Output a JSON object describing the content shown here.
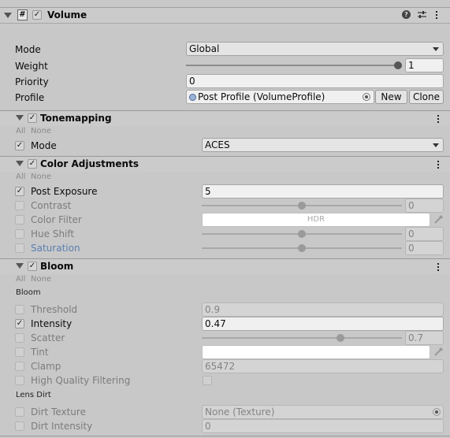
{
  "component": {
    "title": "Volume",
    "enabled": true,
    "icons": [
      "help-icon",
      "presets-icon",
      "more-icon"
    ]
  },
  "volume": {
    "mode_label": "Mode",
    "mode_value": "Global",
    "weight_label": "Weight",
    "weight_value": "1",
    "weight_fraction": 1,
    "priority_label": "Priority",
    "priority_value": "0",
    "profile_label": "Profile",
    "profile_value": "Post Profile (VolumeProfile)",
    "new_button": "New",
    "clone_button": "Clone"
  },
  "all_label": "All",
  "none_label": "None",
  "tonemapping": {
    "title": "Tonemapping",
    "mode_label": "Mode",
    "mode_value": "ACES"
  },
  "color_adjustments": {
    "title": "Color Adjustments",
    "post_exposure_label": "Post Exposure",
    "post_exposure_value": "5",
    "contrast_label": "Contrast",
    "contrast_value": "0",
    "contrast_fraction": 0.5,
    "color_filter_label": "Color Filter",
    "color_filter_hdr": "HDR",
    "hue_shift_label": "Hue Shift",
    "hue_shift_value": "0",
    "hue_shift_fraction": 0.5,
    "saturation_label": "Saturation",
    "saturation_value": "0",
    "saturation_fraction": 0.5
  },
  "bloom": {
    "title": "Bloom",
    "group_bloom": "Bloom",
    "threshold_label": "Threshold",
    "threshold_value": "0.9",
    "intensity_label": "Intensity",
    "intensity_value": "0.47",
    "scatter_label": "Scatter",
    "scatter_value": "0.7",
    "scatter_fraction": 0.7,
    "tint_label": "Tint",
    "clamp_label": "Clamp",
    "clamp_value": "65472",
    "hq_label": "High Quality Filtering",
    "group_lens_dirt": "Lens Dirt",
    "dirt_texture_label": "Dirt Texture",
    "dirt_texture_value": "None (Texture)",
    "dirt_intensity_label": "Dirt Intensity",
    "dirt_intensity_value": "0"
  }
}
